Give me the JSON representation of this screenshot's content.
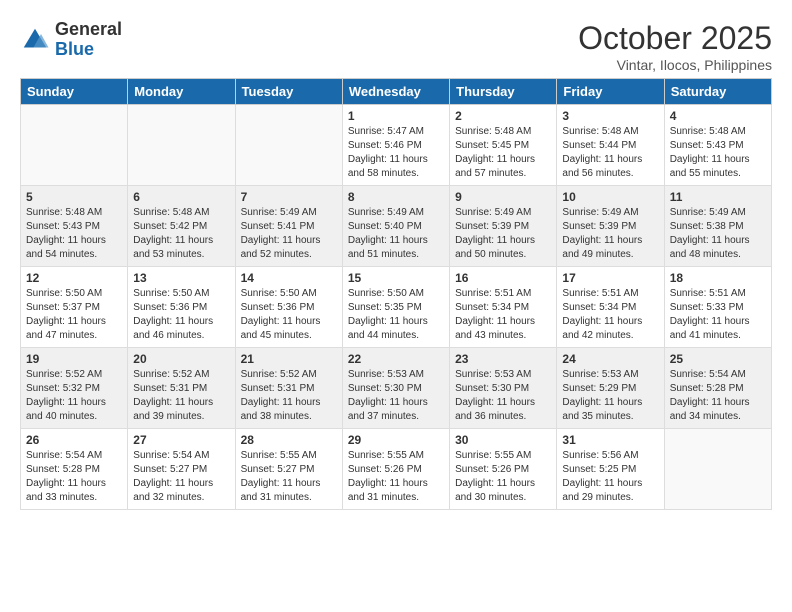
{
  "logo": {
    "general": "General",
    "blue": "Blue"
  },
  "title": "October 2025",
  "location": "Vintar, Ilocos, Philippines",
  "days_of_week": [
    "Sunday",
    "Monday",
    "Tuesday",
    "Wednesday",
    "Thursday",
    "Friday",
    "Saturday"
  ],
  "weeks": [
    [
      {
        "day": "",
        "info": ""
      },
      {
        "day": "",
        "info": ""
      },
      {
        "day": "",
        "info": ""
      },
      {
        "day": "1",
        "info": "Sunrise: 5:47 AM\nSunset: 5:46 PM\nDaylight: 11 hours\nand 58 minutes."
      },
      {
        "day": "2",
        "info": "Sunrise: 5:48 AM\nSunset: 5:45 PM\nDaylight: 11 hours\nand 57 minutes."
      },
      {
        "day": "3",
        "info": "Sunrise: 5:48 AM\nSunset: 5:44 PM\nDaylight: 11 hours\nand 56 minutes."
      },
      {
        "day": "4",
        "info": "Sunrise: 5:48 AM\nSunset: 5:43 PM\nDaylight: 11 hours\nand 55 minutes."
      }
    ],
    [
      {
        "day": "5",
        "info": "Sunrise: 5:48 AM\nSunset: 5:43 PM\nDaylight: 11 hours\nand 54 minutes."
      },
      {
        "day": "6",
        "info": "Sunrise: 5:48 AM\nSunset: 5:42 PM\nDaylight: 11 hours\nand 53 minutes."
      },
      {
        "day": "7",
        "info": "Sunrise: 5:49 AM\nSunset: 5:41 PM\nDaylight: 11 hours\nand 52 minutes."
      },
      {
        "day": "8",
        "info": "Sunrise: 5:49 AM\nSunset: 5:40 PM\nDaylight: 11 hours\nand 51 minutes."
      },
      {
        "day": "9",
        "info": "Sunrise: 5:49 AM\nSunset: 5:39 PM\nDaylight: 11 hours\nand 50 minutes."
      },
      {
        "day": "10",
        "info": "Sunrise: 5:49 AM\nSunset: 5:39 PM\nDaylight: 11 hours\nand 49 minutes."
      },
      {
        "day": "11",
        "info": "Sunrise: 5:49 AM\nSunset: 5:38 PM\nDaylight: 11 hours\nand 48 minutes."
      }
    ],
    [
      {
        "day": "12",
        "info": "Sunrise: 5:50 AM\nSunset: 5:37 PM\nDaylight: 11 hours\nand 47 minutes."
      },
      {
        "day": "13",
        "info": "Sunrise: 5:50 AM\nSunset: 5:36 PM\nDaylight: 11 hours\nand 46 minutes."
      },
      {
        "day": "14",
        "info": "Sunrise: 5:50 AM\nSunset: 5:36 PM\nDaylight: 11 hours\nand 45 minutes."
      },
      {
        "day": "15",
        "info": "Sunrise: 5:50 AM\nSunset: 5:35 PM\nDaylight: 11 hours\nand 44 minutes."
      },
      {
        "day": "16",
        "info": "Sunrise: 5:51 AM\nSunset: 5:34 PM\nDaylight: 11 hours\nand 43 minutes."
      },
      {
        "day": "17",
        "info": "Sunrise: 5:51 AM\nSunset: 5:34 PM\nDaylight: 11 hours\nand 42 minutes."
      },
      {
        "day": "18",
        "info": "Sunrise: 5:51 AM\nSunset: 5:33 PM\nDaylight: 11 hours\nand 41 minutes."
      }
    ],
    [
      {
        "day": "19",
        "info": "Sunrise: 5:52 AM\nSunset: 5:32 PM\nDaylight: 11 hours\nand 40 minutes."
      },
      {
        "day": "20",
        "info": "Sunrise: 5:52 AM\nSunset: 5:31 PM\nDaylight: 11 hours\nand 39 minutes."
      },
      {
        "day": "21",
        "info": "Sunrise: 5:52 AM\nSunset: 5:31 PM\nDaylight: 11 hours\nand 38 minutes."
      },
      {
        "day": "22",
        "info": "Sunrise: 5:53 AM\nSunset: 5:30 PM\nDaylight: 11 hours\nand 37 minutes."
      },
      {
        "day": "23",
        "info": "Sunrise: 5:53 AM\nSunset: 5:30 PM\nDaylight: 11 hours\nand 36 minutes."
      },
      {
        "day": "24",
        "info": "Sunrise: 5:53 AM\nSunset: 5:29 PM\nDaylight: 11 hours\nand 35 minutes."
      },
      {
        "day": "25",
        "info": "Sunrise: 5:54 AM\nSunset: 5:28 PM\nDaylight: 11 hours\nand 34 minutes."
      }
    ],
    [
      {
        "day": "26",
        "info": "Sunrise: 5:54 AM\nSunset: 5:28 PM\nDaylight: 11 hours\nand 33 minutes."
      },
      {
        "day": "27",
        "info": "Sunrise: 5:54 AM\nSunset: 5:27 PM\nDaylight: 11 hours\nand 32 minutes."
      },
      {
        "day": "28",
        "info": "Sunrise: 5:55 AM\nSunset: 5:27 PM\nDaylight: 11 hours\nand 31 minutes."
      },
      {
        "day": "29",
        "info": "Sunrise: 5:55 AM\nSunset: 5:26 PM\nDaylight: 11 hours\nand 31 minutes."
      },
      {
        "day": "30",
        "info": "Sunrise: 5:55 AM\nSunset: 5:26 PM\nDaylight: 11 hours\nand 30 minutes."
      },
      {
        "day": "31",
        "info": "Sunrise: 5:56 AM\nSunset: 5:25 PM\nDaylight: 11 hours\nand 29 minutes."
      },
      {
        "day": "",
        "info": ""
      }
    ]
  ]
}
